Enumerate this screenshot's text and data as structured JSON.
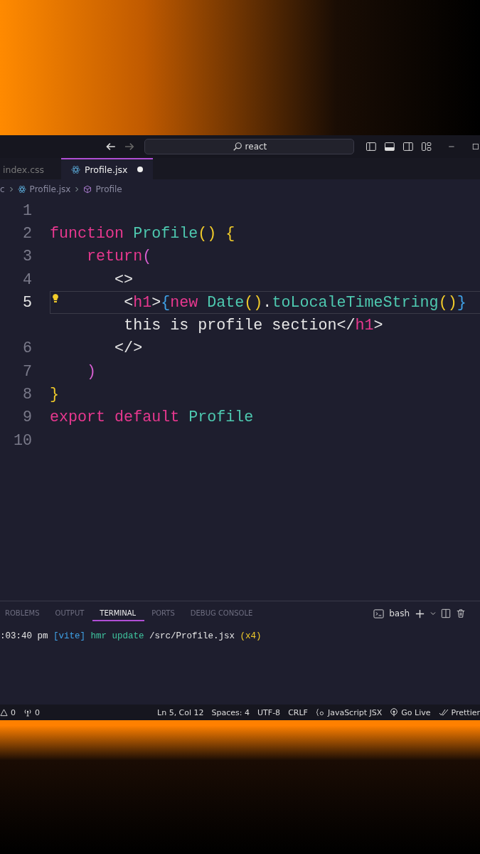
{
  "title_bar": {
    "back_enabled": true,
    "forward_enabled": false,
    "search": {
      "value": "react"
    }
  },
  "tabs": [
    {
      "label": "index.css",
      "selected": false,
      "modified": false,
      "kind": "css"
    },
    {
      "label": "Profile.jsx",
      "selected": true,
      "modified": true,
      "kind": "react"
    }
  ],
  "breadcrumb": [
    {
      "label": "c",
      "kind": "folder"
    },
    {
      "label": "Profile.jsx",
      "kind": "react"
    },
    {
      "label": "Profile",
      "kind": "symbol"
    }
  ],
  "editor": {
    "lines": [
      {
        "number": "1",
        "current": false
      },
      {
        "number": "2",
        "current": false,
        "tokens": [
          {
            "text": "function ",
            "kind": "keyword"
          },
          {
            "text": "Profile",
            "kind": "name"
          },
          {
            "text": "() {",
            "kind": "bracket"
          }
        ]
      },
      {
        "number": "3",
        "current": false,
        "tokens": [
          {
            "text": "    return",
            "kind": "keyword"
          },
          {
            "text": "(",
            "kind": "bracket2"
          }
        ]
      },
      {
        "number": "4",
        "current": false,
        "tokens": [
          {
            "text": "       <>",
            "kind": "plain"
          }
        ]
      },
      {
        "number": "5",
        "current": true,
        "lightbulb": true,
        "tokens": [
          {
            "text": "        <",
            "kind": "plain"
          },
          {
            "text": "h1",
            "kind": "tag"
          },
          {
            "text": ">",
            "kind": "plain"
          },
          {
            "text": "{",
            "kind": "brace"
          },
          {
            "text": "new ",
            "kind": "keyword"
          },
          {
            "text": "Date",
            "kind": "name"
          },
          {
            "text": "()",
            "kind": "bracket"
          },
          {
            "text": ".",
            "kind": "plain"
          },
          {
            "text": "toLocaleTimeString",
            "kind": "name"
          },
          {
            "text": "()",
            "kind": "bracket"
          },
          {
            "text": "}",
            "kind": "brace"
          }
        ],
        "continuation": [
          {
            "text": "        this is profile section</",
            "kind": "plain"
          },
          {
            "text": "h1",
            "kind": "tag"
          },
          {
            "text": ">",
            "kind": "plain"
          }
        ]
      },
      {
        "number": "6",
        "current": false,
        "tokens": [
          {
            "text": "       </>",
            "kind": "plain"
          }
        ]
      },
      {
        "number": "7",
        "current": false,
        "tokens": [
          {
            "text": "    )",
            "kind": "bracket2"
          }
        ]
      },
      {
        "number": "8",
        "current": false,
        "tokens": [
          {
            "text": "}",
            "kind": "bracket"
          }
        ]
      },
      {
        "number": "9",
        "current": false,
        "tokens": [
          {
            "text": "export default ",
            "kind": "keyword"
          },
          {
            "text": "Profile",
            "kind": "name"
          }
        ]
      },
      {
        "number": "10",
        "current": false
      }
    ]
  },
  "panel": {
    "tabs": [
      {
        "label": "ROBLEMS",
        "selected": false
      },
      {
        "label": "OUTPUT",
        "selected": false
      },
      {
        "label": "TERMINAL",
        "selected": true
      },
      {
        "label": "PORTS",
        "selected": false
      },
      {
        "label": "DEBUG CONSOLE",
        "selected": false
      }
    ],
    "shell": "bash",
    "terminal_lines": [
      [
        {
          "text": ":03:40 pm ",
          "kind": "plain"
        },
        {
          "text": "[vite]",
          "kind": "brace"
        },
        {
          "text": " hmr update",
          "kind": "green"
        },
        {
          "text": " /src/Profile.jsx ",
          "kind": "plain"
        },
        {
          "text": "(x4)",
          "kind": "bracket"
        }
      ]
    ]
  },
  "status_bar": {
    "left": [
      {
        "text": "0",
        "kind": "warning"
      },
      {
        "text": "0",
        "kind": "ports"
      }
    ],
    "right": [
      {
        "text": "Ln 5, Col 12",
        "kind": "text"
      },
      {
        "text": "Spaces: 4",
        "kind": "text"
      },
      {
        "text": "UTF-8",
        "kind": "text"
      },
      {
        "text": "CRLF",
        "kind": "text"
      },
      {
        "text": "JavaScript JSX",
        "kind": "language"
      },
      {
        "text": "Go Live",
        "kind": "live"
      },
      {
        "text": "Prettier",
        "kind": "prettier"
      }
    ]
  }
}
